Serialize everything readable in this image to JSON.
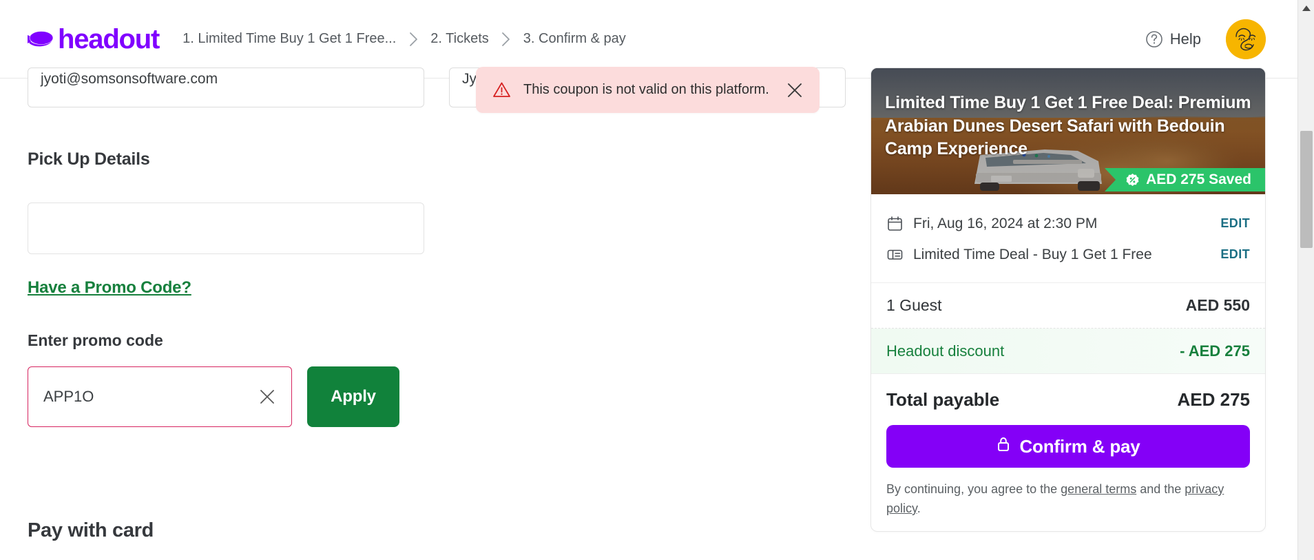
{
  "header": {
    "logo_text": "headout",
    "breadcrumb": [
      {
        "label": "1. Limited Time Buy 1 Get 1 Free..."
      },
      {
        "label": "2. Tickets"
      },
      {
        "label": "3. Confirm & pay"
      }
    ],
    "help_label": "Help",
    "brand_color": "#8000ff"
  },
  "toast": {
    "message": "This coupon is not valid on this platform.",
    "bg_color": "#fcdcdc",
    "icon": "warning-triangle-icon",
    "close_icon": "close-icon"
  },
  "form": {
    "email_value": "jyoti@somsonsoftware.com",
    "second_field_value": "Jy",
    "pickup_section_title": "Pick Up Details",
    "pickup_value": "",
    "promo_link": "Have a Promo Code?",
    "promo_label": "Enter promo code",
    "promo_value": "APP1O",
    "promo_placeholder": "Enter promo code",
    "apply_label": "Apply",
    "promo_border_color": "#d6245f",
    "apply_color": "#11823b",
    "pay_title": "Pay with card"
  },
  "summary": {
    "product_title": "Limited Time Buy 1 Get 1 Free Deal: Premium Arabian Dunes Desert Safari with Bedouin Camp Experience",
    "saved_badge": "AED 275 Saved",
    "saved_badge_color": "#2bc46a",
    "meta": [
      {
        "icon": "calendar-icon",
        "text": "Fri, Aug 16, 2024 at 2:30 PM",
        "action": "EDIT"
      },
      {
        "icon": "ticket-icon",
        "text": "Limited Time Deal - Buy 1 Get 1 Free",
        "action": "EDIT"
      }
    ],
    "prices": [
      {
        "label": "1 Guest",
        "amount": "AED 550"
      },
      {
        "label": "Headout discount",
        "amount": "- AED 275"
      },
      {
        "label": "Total payable",
        "amount": "AED 275"
      }
    ],
    "confirm_label": "Confirm & pay",
    "confirm_color": "#8400f7",
    "lock_icon": "lock-icon",
    "terms_prefix": "By continuing, you agree to the ",
    "terms_link_1": "general terms",
    "terms_middle": " and the ",
    "terms_link_2": "privacy policy",
    "terms_suffix": "."
  }
}
